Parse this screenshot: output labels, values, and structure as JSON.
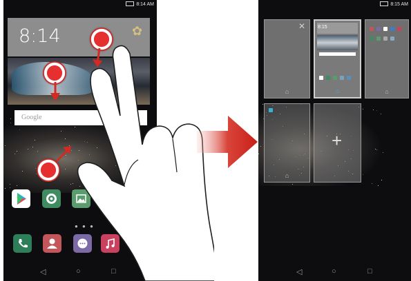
{
  "left_screen": {
    "status_time": "8:14 AM",
    "clock_time": "8:14",
    "search_placeholder": "Google"
  },
  "right_screen": {
    "status_time": "8:15 AM",
    "preview_clock": "8:15"
  },
  "colors": {
    "touch_marker": "#e5302f",
    "transition_arrow": "#d42a22",
    "accent_home": "#3ab0d6"
  },
  "icons": {
    "left_widget": "gear-icon",
    "right_card": "close-icon",
    "add_screen": "plus-icon",
    "navigation": [
      "back-icon",
      "home-icon",
      "recents-icon"
    ]
  }
}
